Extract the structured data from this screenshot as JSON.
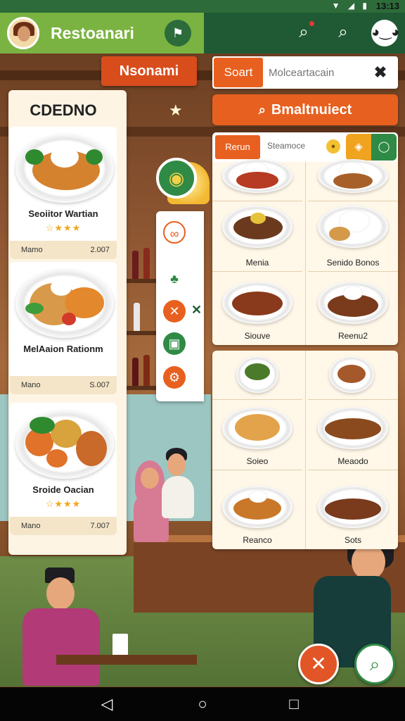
{
  "status_bar": {
    "time": "13:13",
    "icons": "▼ ◢ ▮"
  },
  "top_bar": {
    "title": "Restoanari",
    "left_action_icon": "flag-icon",
    "right_icons": [
      "search-icon",
      "search-icon",
      "mascot-icon"
    ],
    "colors": {
      "left": "#7bb342",
      "right": "#1f5a34"
    }
  },
  "nav_banner": {
    "label": "Nsonami"
  },
  "left_menu": {
    "title": "CDEDNO",
    "items": [
      {
        "name": "Seoiitor Wartian",
        "rating": "☆★★★",
        "left_label": "Mamo",
        "right_label": "2.007"
      },
      {
        "name": "MelAaion Rationm",
        "rating": "",
        "left_label": "Mano",
        "right_label": "S.007"
      },
      {
        "name": "Sroide Oacian",
        "rating": "☆★★★",
        "left_label": "Mano",
        "right_label": "7.007"
      }
    ]
  },
  "search": {
    "tag": "Soart",
    "placeholder": "Molceartacain",
    "primary_button": "Bmaltnuiect"
  },
  "filter": {
    "tag": "Rerun",
    "text": "Steamoce"
  },
  "grid_top": {
    "items": [
      {
        "label": ""
      },
      {
        "label": ""
      },
      {
        "label": "Menia"
      },
      {
        "label": "Senido Bonos"
      },
      {
        "label": "Siouve"
      },
      {
        "label": "Reenu2"
      }
    ]
  },
  "grid_bottom": {
    "items": [
      {
        "label": ""
      },
      {
        "label": ""
      },
      {
        "label": "Soieo"
      },
      {
        "label": "Meaodo"
      },
      {
        "label": "Reanco"
      },
      {
        "label": "Sots"
      }
    ]
  },
  "accent": {
    "orange": "#e8601f",
    "green": "#2f8a45",
    "star": "#f0a81e"
  }
}
